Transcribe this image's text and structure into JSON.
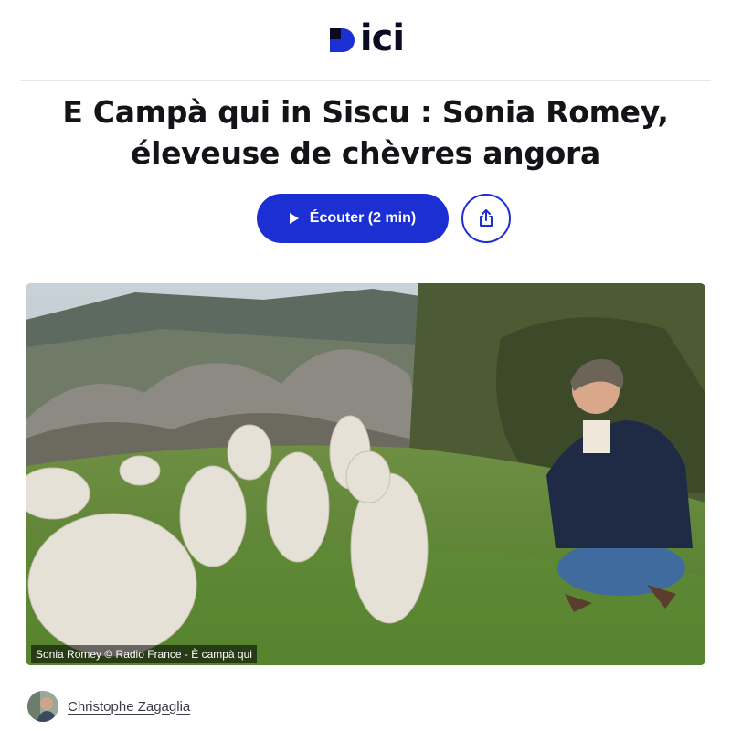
{
  "brand": {
    "logo_text": "ici",
    "logo_color": "#1b2fd3"
  },
  "article": {
    "title_line1": "E Campà qui in Siscu : Sonia Romey,",
    "title_line2": "éleveuse de chèvres angora"
  },
  "actions": {
    "listen_label": "Écouter (2 min)",
    "listen_icon": "play-icon",
    "share_icon": "share-icon",
    "accent": "#1b2fd3"
  },
  "photo": {
    "caption": "Sonia Romey © Radio France - È campà qui"
  },
  "author": {
    "name": "Christophe Zagaglia",
    "avatar_icon": "avatar"
  }
}
